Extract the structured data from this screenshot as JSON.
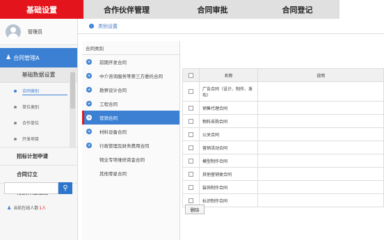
{
  "topnav": {
    "tabs": [
      {
        "label": "基础设置"
      },
      {
        "label": "合作伙伴管理"
      },
      {
        "label": "合同审批"
      },
      {
        "label": "合同登记"
      }
    ]
  },
  "user": {
    "name": "管理员"
  },
  "sidebar": {
    "module_title": "合同管理A",
    "group_title": "基础数据设置",
    "sub_items": [
      "合同类别",
      "单位类别",
      "合作单位",
      "开发项目"
    ],
    "menu_items": [
      "招标计划申请",
      "合同订立",
      "付款计划编制"
    ],
    "online": {
      "label": "当前在线人数",
      "count": "1人"
    }
  },
  "breadcrumb": {
    "text": "类别设置"
  },
  "category_panel": {
    "header": "合同类别",
    "items": [
      {
        "label": "前期开发合同",
        "icon": "plus-icon"
      },
      {
        "label": "中介咨询服务等第三方委托合同",
        "icon": "plus-icon"
      },
      {
        "label": "勘察设计合同",
        "icon": "plus-icon"
      },
      {
        "label": "工程合同",
        "icon": "plus-icon"
      },
      {
        "label": "营销合同",
        "icon": "plus-icon",
        "active": true
      },
      {
        "label": "材料设备合同",
        "icon": "plus-icon"
      },
      {
        "label": "行政管理及财务费用合同",
        "icon": "plus-icon"
      },
      {
        "label": "物业专项维修资金合同",
        "icon": ""
      },
      {
        "label": "其他零星合同",
        "icon": ""
      }
    ]
  },
  "table": {
    "headers": [
      "名称",
      "说明"
    ],
    "rows": [
      {
        "name": "广告合同（设计、制作、发布）",
        "desc": ""
      },
      {
        "name": "销售代理合同",
        "desc": ""
      },
      {
        "name": "物料采购合同",
        "desc": ""
      },
      {
        "name": "公关合同",
        "desc": ""
      },
      {
        "name": "营销活动合同",
        "desc": ""
      },
      {
        "name": "模型制作合同",
        "desc": ""
      },
      {
        "name": "其他营销类合同",
        "desc": ""
      },
      {
        "name": "装饰制作合同",
        "desc": ""
      },
      {
        "name": "标识制作合同",
        "desc": ""
      }
    ]
  },
  "buttons": {
    "delete": "删除"
  },
  "colors": {
    "accent": "#e3141b",
    "primary": "#3c80d4"
  }
}
